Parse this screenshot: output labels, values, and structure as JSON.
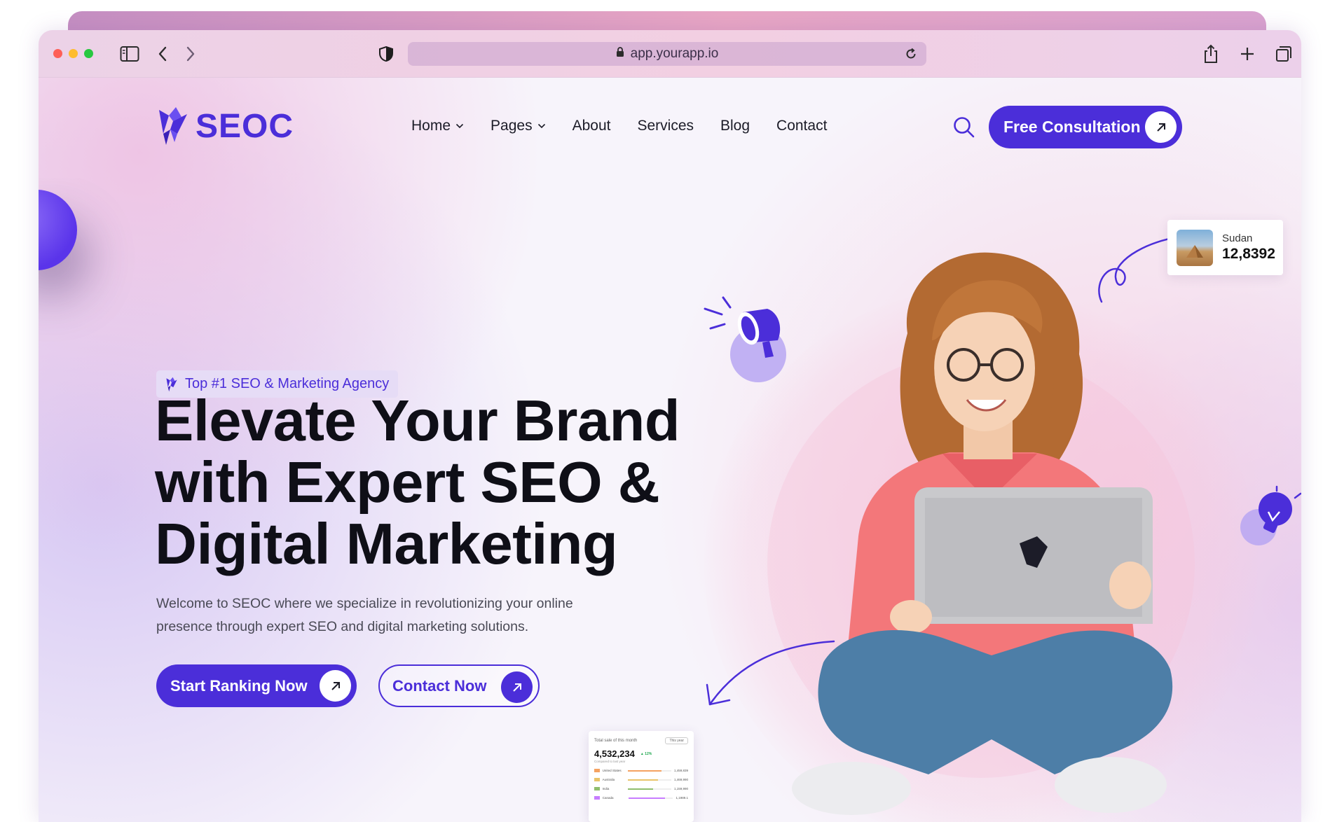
{
  "browser": {
    "address": "app.yourapp.io"
  },
  "nav": {
    "logo_text": "SEOC",
    "items": [
      {
        "label": "Home",
        "has_dropdown": true
      },
      {
        "label": "Pages",
        "has_dropdown": true
      },
      {
        "label": "About",
        "has_dropdown": false
      },
      {
        "label": "Services",
        "has_dropdown": false
      },
      {
        "label": "Blog",
        "has_dropdown": false
      },
      {
        "label": "Contact",
        "has_dropdown": false
      }
    ],
    "cta_label": "Free Consultation"
  },
  "hero": {
    "badge": "Top #1 SEO & Marketing Agency",
    "title_lines": [
      "Elevate Your Brand",
      "with Expert SEO &",
      "Digital Marketing"
    ],
    "description_lines": [
      "Welcome to SEOC where we specialize in revolutionizing your online",
      "presence through expert SEO and digital marketing solutions."
    ],
    "primary_button": "Start Ranking Now",
    "secondary_button": "Contact Now"
  },
  "stat_card": {
    "label": "Sudan",
    "value": "12,8392"
  },
  "mini_card": {
    "title": "Total sale of this month",
    "period": "This year",
    "value": "4,532,234",
    "change": "▲ 12%",
    "subtitle": "Compared to last year",
    "rows": [
      {
        "name": "United States",
        "value": "1,459,839",
        "fill": 0.78,
        "color": "#f4a261"
      },
      {
        "name": "Australia",
        "value": "1,469,990",
        "fill": 0.7,
        "color": "#e9c46a"
      },
      {
        "name": "India",
        "value": "1,159,990",
        "fill": 0.58,
        "color": "#90be6d"
      },
      {
        "name": "Canada",
        "value": "1,1989.1",
        "fill": 0.82,
        "color": "#c77dff"
      }
    ]
  },
  "colors": {
    "brand": "#4b2ed9",
    "text_dark": "#0f0f17"
  }
}
